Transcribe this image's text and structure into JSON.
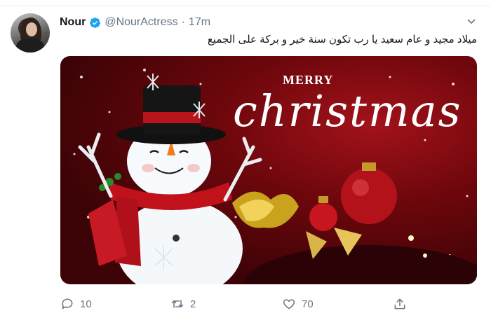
{
  "tweet": {
    "author_name": "Nour",
    "handle": "@NourActress",
    "separator": "·",
    "time": "17m",
    "text": "ميلاد مجيد و عام سعيد يا رب تكون سنة خير و بركة على الجميع",
    "verified_color": "#1da1f2"
  },
  "media": {
    "line1": "MERRY",
    "line2": "christmas"
  },
  "actions": {
    "replies": "10",
    "retweets": "2",
    "likes": "70"
  },
  "icons": [
    "avatar",
    "verified-badge-icon",
    "chevron-down-icon",
    "reply-icon",
    "retweet-icon",
    "like-icon",
    "share-icon"
  ]
}
